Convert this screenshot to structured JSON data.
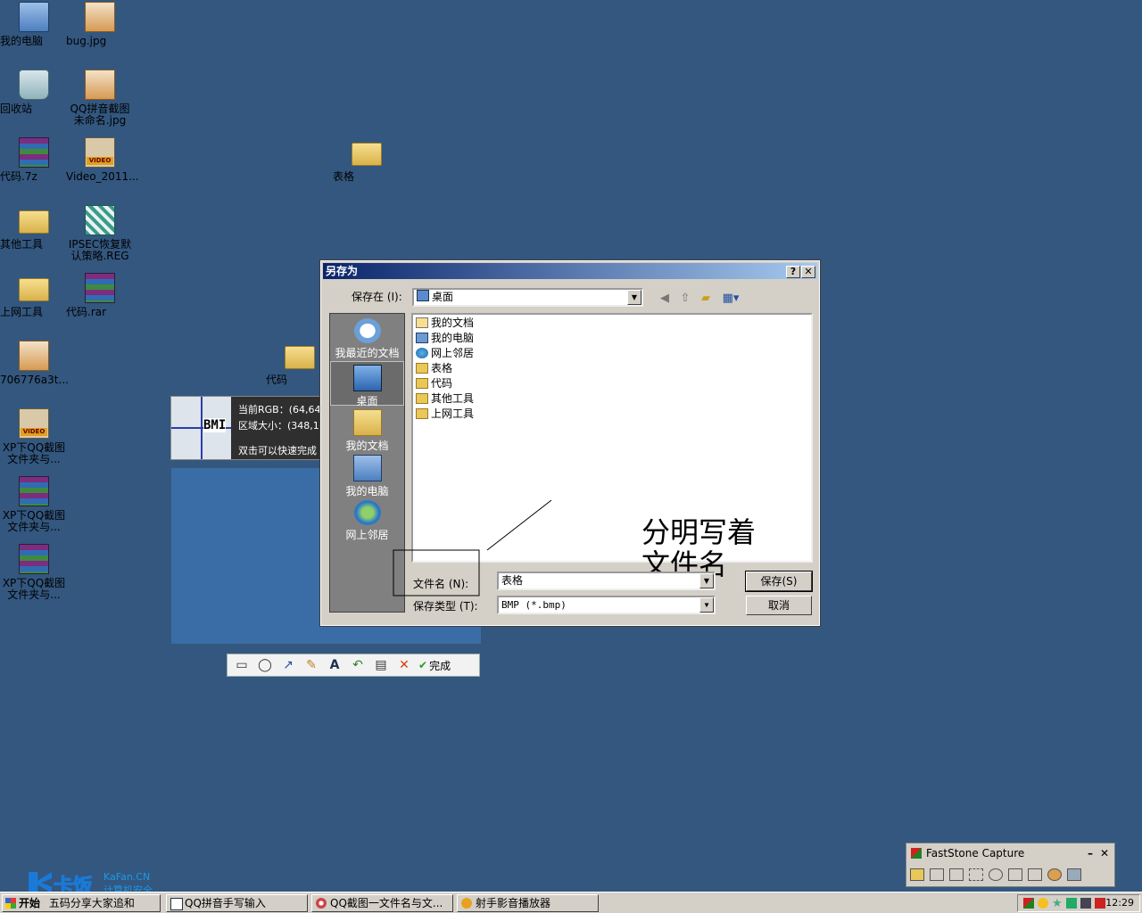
{
  "desktop_icons": [
    {
      "label": "我的电脑",
      "icon": "computer-icon"
    },
    {
      "label": "bug.jpg",
      "icon": "image-file-icon"
    },
    {
      "label": "回收站",
      "icon": "recycle-bin-icon"
    },
    {
      "label": "QQ拼音截图未命名.jpg",
      "icon": "image-file-icon"
    },
    {
      "label": "代码.7z",
      "icon": "archive-icon"
    },
    {
      "label": "Video_2011...",
      "icon": "video-file-icon"
    },
    {
      "label": "表格",
      "icon": "folder-icon"
    },
    {
      "label": "其他工具",
      "icon": "folder-icon"
    },
    {
      "label": "IPSEC恢复默认策略.REG",
      "icon": "registry-file-icon"
    },
    {
      "label": "上网工具",
      "icon": "folder-icon"
    },
    {
      "label": "代码.rar",
      "icon": "archive-icon"
    },
    {
      "label": "706776a3t...",
      "icon": "image-file-icon"
    },
    {
      "label": "代码",
      "icon": "folder-icon"
    },
    {
      "label": "XP下QQ截图文件夹与...",
      "icon": "video-file-icon"
    },
    {
      "label": "XP下QQ截图文件夹与...",
      "icon": "archive-icon"
    },
    {
      "label": "XP下QQ截图文件夹与...",
      "icon": "archive-icon"
    }
  ],
  "capture_overlay": {
    "rgb_text": "当前RGB：(64,64,",
    "size_text": "区域大小：(348,1",
    "hint_text": "双击可以快速完成",
    "thumb_text": "BMI",
    "done_label": "完成"
  },
  "dialog": {
    "title": "另存为",
    "help_btn": "?",
    "close_btn": "✕",
    "save_in_label": "保存在 (I):",
    "save_in_value": "桌面",
    "places": [
      {
        "label": "我最近的文档",
        "icon": "recent-docs-icon"
      },
      {
        "label": "桌面",
        "icon": "desktop-icon"
      },
      {
        "label": "我的文档",
        "icon": "my-documents-icon"
      },
      {
        "label": "我的电脑",
        "icon": "my-computer-icon"
      },
      {
        "label": "网上邻居",
        "icon": "network-places-icon"
      }
    ],
    "files": [
      {
        "name": "我的文档",
        "icon": "my-documents-icon"
      },
      {
        "name": "我的电脑",
        "icon": "my-computer-icon"
      },
      {
        "name": "网上邻居",
        "icon": "network-places-icon"
      },
      {
        "name": "表格",
        "icon": "folder-icon"
      },
      {
        "name": "代码",
        "icon": "folder-icon"
      },
      {
        "name": "其他工具",
        "icon": "folder-icon"
      },
      {
        "name": "上网工具",
        "icon": "folder-icon"
      }
    ],
    "annotation": "分明写着\n文件名",
    "filename_label": "文件名 (N):",
    "filename_value": "表格",
    "filetype_label": "保存类型 (T):",
    "filetype_value": "BMP (*.bmp)",
    "save_btn": "保存(S)",
    "cancel_btn": "取消"
  },
  "faststone": {
    "title": "FastStone Capture",
    "min": "–",
    "close": "✕"
  },
  "taskbar": {
    "start_label": "开始",
    "items": [
      "QQ拼音手写输入",
      "QQ截图一文件名与文...",
      "射手影音播放器"
    ],
    "clock": "12:29"
  },
  "watermark": {
    "brand": "卡饭",
    "site": "KaFan.CN",
    "slogan": "计算机安全",
    "ime_bar": "五码分享大家追和"
  },
  "colors": {
    "desktop": "#33577f",
    "titlebar_start": "#0a246a",
    "titlebar_end": "#a6caf0",
    "dialog_face": "#d4d0c8"
  }
}
